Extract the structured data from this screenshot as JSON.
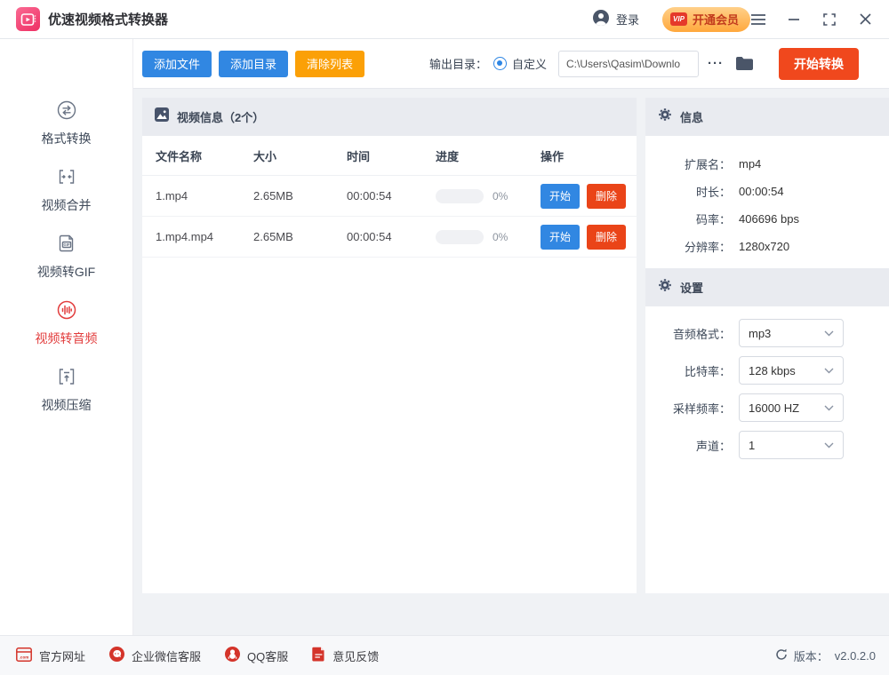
{
  "titlebar": {
    "app_title": "优速视频格式转换器",
    "login_label": "登录",
    "vip_badge": "VIP",
    "vip_label": "开通会员",
    "window_controls": [
      "menu-icon",
      "minimize-icon",
      "maximize-icon",
      "close-icon"
    ]
  },
  "toolbar": {
    "add_file": "添加文件",
    "add_dir": "添加目录",
    "clear_list": "清除列表",
    "output_dir_label": "输出目录：",
    "custom_label": "自定义",
    "output_path": "C:\\Users\\Qasim\\Downlo",
    "more_label": "···",
    "start_convert": "开始转换"
  },
  "sidebar": {
    "items": [
      {
        "label": "格式转换",
        "icon": "format-convert-icon",
        "active": false
      },
      {
        "label": "视频合并",
        "icon": "video-merge-icon",
        "active": false
      },
      {
        "label": "视频转GIF",
        "icon": "video-to-gif-icon",
        "active": false
      },
      {
        "label": "视频转音频",
        "icon": "video-to-audio-icon",
        "active": true
      },
      {
        "label": "视频压缩",
        "icon": "video-compress-icon",
        "active": false
      }
    ]
  },
  "file_panel": {
    "icon": "image-icon",
    "title": "视频信息（2个）",
    "columns": [
      "文件名称",
      "大小",
      "时间",
      "进度",
      "操作"
    ],
    "start_label": "开始",
    "delete_label": "删除",
    "rows": [
      {
        "name": "1.mp4",
        "size": "2.65MB",
        "time": "00:00:54",
        "progress": "0%"
      },
      {
        "name": "1.mp4.mp4",
        "size": "2.65MB",
        "time": "00:00:54",
        "progress": "0%"
      }
    ]
  },
  "info_panel": {
    "icon": "gear-icon",
    "title": "信息",
    "fields": [
      {
        "label": "扩展名：",
        "value": "mp4"
      },
      {
        "label": "时长：",
        "value": "00:00:54"
      },
      {
        "label": "码率：",
        "value": "406696 bps"
      },
      {
        "label": "分辨率：",
        "value": "1280x720"
      }
    ]
  },
  "settings_panel": {
    "icon": "gear-icon",
    "title": "设置",
    "fields": [
      {
        "label": "音频格式：",
        "value": "mp3"
      },
      {
        "label": "比特率：",
        "value": "128 kbps"
      },
      {
        "label": "采样频率：",
        "value": "16000 HZ"
      },
      {
        "label": "声道：",
        "value": "1"
      }
    ]
  },
  "footer": {
    "links": [
      {
        "label": "官方网址",
        "icon": "website-icon"
      },
      {
        "label": "企业微信客服",
        "icon": "wechat-service-icon"
      },
      {
        "label": "QQ客服",
        "icon": "qq-service-icon"
      },
      {
        "label": "意见反馈",
        "icon": "feedback-icon"
      }
    ],
    "version_label": "版本：",
    "version": "v2.0.2.0"
  },
  "colors": {
    "primary_blue": "#3187e2",
    "warning_orange": "#fba007",
    "action_red": "#f0481d",
    "delete_red": "#ea4418",
    "active_item_red": "#e23d3d",
    "footer_icon_red": "#d4342a",
    "section_header_bg": "#e9ebf0",
    "content_bg": "#f0f2f5"
  }
}
